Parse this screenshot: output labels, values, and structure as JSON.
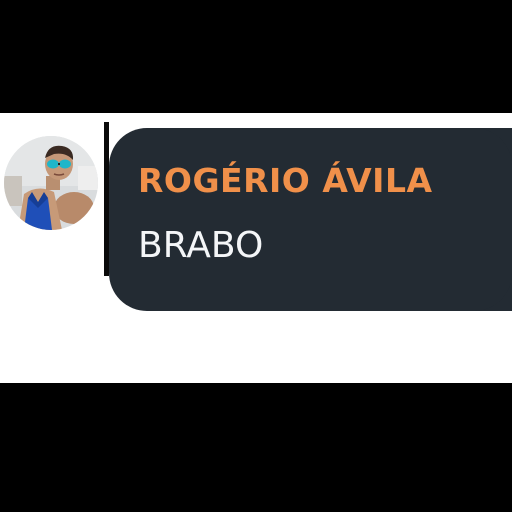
{
  "message": {
    "sender_name": "ROGÉRIO ÁVILA",
    "text": "BRABO"
  },
  "avatar": {
    "icon": "profile-photo"
  },
  "colors": {
    "bubble": "#232b33",
    "sender_name": "#f0904a",
    "message_text": "#f4f6f8",
    "background": "#000000",
    "sticker_area": "#ffffff"
  }
}
